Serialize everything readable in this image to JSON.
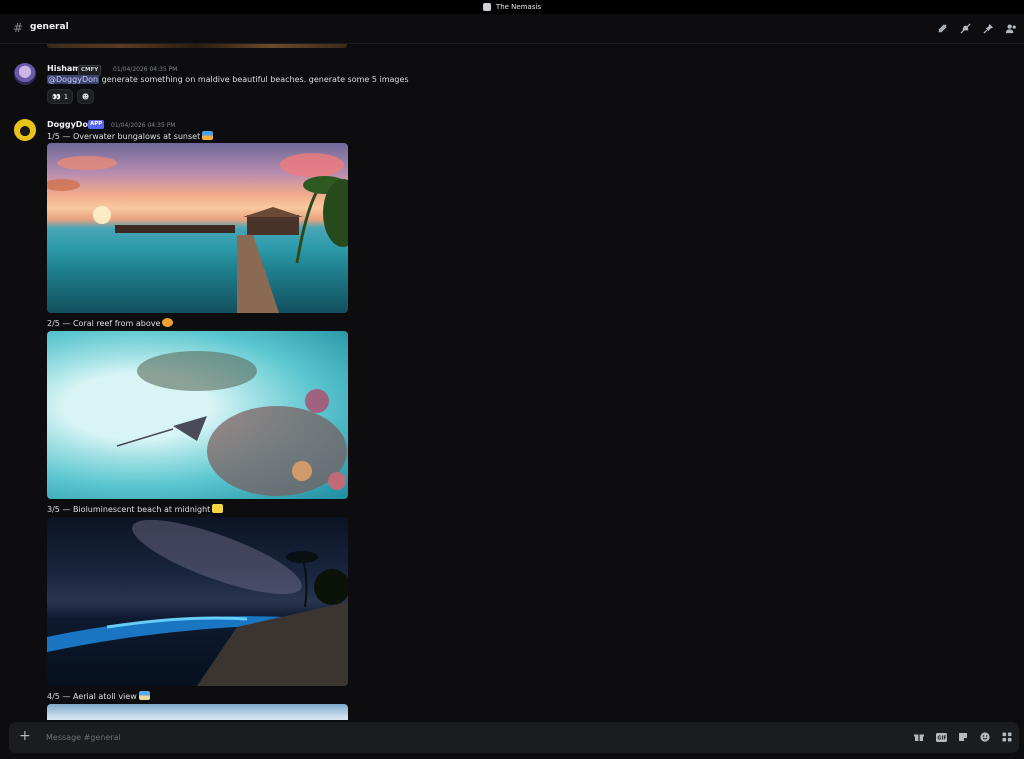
{
  "window": {
    "title": "The Nemasis"
  },
  "channel": {
    "name": "general"
  },
  "messages": [
    {
      "author": "Hisham",
      "badge": "CMFY",
      "timestamp": "01/04/2026 04:35 PM",
      "mention": "@DoggyDon",
      "text": " generate something on maldive beautiful beaches. generate some 5 images",
      "reactions": [
        {
          "emoji": "👀",
          "count": "1"
        },
        {
          "emoji": "☻",
          "count": ""
        }
      ]
    },
    {
      "author": "DoggyDon",
      "badge": "APP",
      "timestamp": "01/04/2026 04:35 PM",
      "captions": [
        {
          "text": "1/5 — Overwater bungalows at sunset",
          "emoji": "🌅"
        },
        {
          "text": "2/5 — Coral reef from above",
          "emoji": "🐠"
        },
        {
          "text": "3/5 — Bioluminescent beach at midnight",
          "emoji": "✨"
        },
        {
          "text": "4/5 — Aerial atoll view",
          "emoji": "🏝"
        }
      ]
    }
  ],
  "composer": {
    "placeholder": "Message #general"
  },
  "icons": {
    "header": [
      "threads-icon",
      "mute-icon",
      "pin-icon",
      "members-icon"
    ],
    "composer": [
      "gift-icon",
      "gif-icon",
      "sticker-icon",
      "emoji-icon",
      "apps-icon"
    ]
  }
}
